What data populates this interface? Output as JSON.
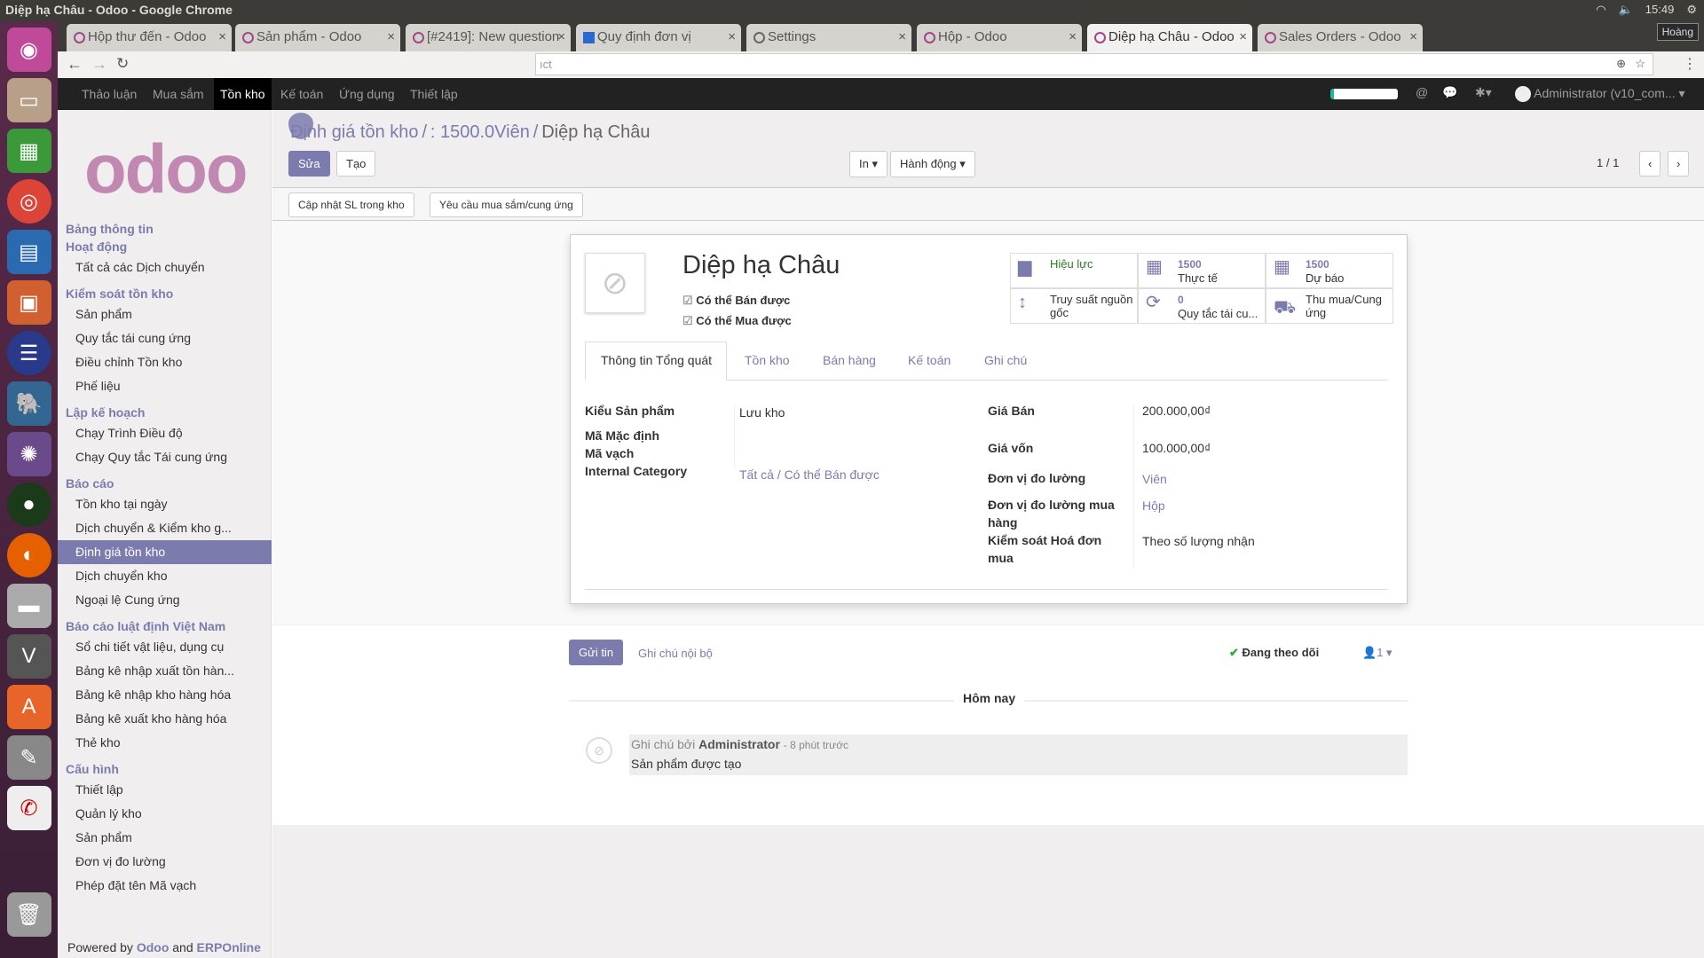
{
  "window_title": "Diệp hạ Châu - Odoo - Google Chrome",
  "tray": {
    "time": "15:49",
    "user": "Hoàng"
  },
  "tabs": [
    {
      "label": "Hộp thư đến - Odoo"
    },
    {
      "label": "Sản phẩm - Odoo"
    },
    {
      "label": "[#2419]: New question"
    },
    {
      "label": "Quy định đơn vị"
    },
    {
      "label": "Settings"
    },
    {
      "label": "Hộp - Odoo"
    },
    {
      "label": "Diệp hạ Châu - Odoo",
      "active": true
    },
    {
      "label": "Sales Orders - Odoo"
    }
  ],
  "address": "ıct",
  "topnav": {
    "items": [
      "Thảo luận",
      "Mua sắm",
      "Tồn kho",
      "Kế toán",
      "Ứng dụng",
      "Thiết lập"
    ],
    "active": "Tồn kho",
    "user": "Administrator (v10_com...",
    "accent": "#7c7bad"
  },
  "sidebar": {
    "logo": "odoo",
    "groups": [
      {
        "title": "Bảng thông tin",
        "items": []
      },
      {
        "title": "Hoạt động",
        "items": [
          "Tất cả các Dịch chuyển"
        ]
      },
      {
        "title": "Kiểm soát tồn kho",
        "items": [
          "Sản phẩm",
          "Quy tắc tái cung ứng",
          "Điều chỉnh Tồn kho",
          "Phế liệu"
        ]
      },
      {
        "title": "Lập kế hoạch",
        "items": [
          "Chạy Trình Điều độ",
          "Chạy Quy tắc Tái cung ứng"
        ]
      },
      {
        "title": "Báo cáo",
        "items": [
          "Tồn kho tại ngày",
          "Dịch chuyển & Kiểm kho g...",
          "Định giá tồn kho",
          "Dịch chuyển kho",
          "Ngoại lệ Cung ứng"
        ]
      },
      {
        "title": "Báo cáo luật định Việt Nam",
        "items": [
          "Sổ chi tiết vật liệu, dụng cụ",
          "Bảng kê nhập xuất tồn hàn...",
          "Bảng kê nhập kho hàng hóa",
          "Bảng kê xuất kho hàng hóa",
          "Thẻ kho"
        ]
      },
      {
        "title": "Cấu hình",
        "items": [
          "Thiết lập",
          "Quản lý kho",
          "Sản phẩm",
          "Đơn vị đo lường",
          "Phép đặt tên Mã vạch"
        ]
      }
    ],
    "selected": "Định giá tồn kho",
    "powered": {
      "prefix": "Powered by",
      "odoo": "Odoo",
      "and": "and",
      "erp": "ERPOnline"
    }
  },
  "control": {
    "breadcrumb": [
      "Định giá tồn kho",
      "/",
      " : 1500.0Viên",
      "/"
    ],
    "current": "Diệp hạ Châu",
    "edit": "Sửa",
    "create": "Tạo",
    "print": "In ▾",
    "action": "Hành động ▾",
    "pager": "1 / 1"
  },
  "header_buttons": [
    "Cập nhật SL trong kho",
    "Yêu cầu mua sắm/cung ứng"
  ],
  "form": {
    "name": "Diệp hạ Châu",
    "sale_ok": "Có thể Bán được",
    "purchase_ok": "Có thể Mua được",
    "stats": [
      {
        "value": "",
        "label": "Hiệu lực",
        "icon": "archive-icon"
      },
      {
        "value": "1500",
        "label": "Thực tế",
        "icon": "building-icon"
      },
      {
        "value": "1500",
        "label": "Dự báo",
        "icon": "building-icon"
      },
      {
        "value": "",
        "label": "Truy suất nguồn gốc",
        "icon": "arrows-v-icon"
      },
      {
        "value": "0",
        "label": "Quy tắc tái cu...",
        "icon": "refresh-icon"
      },
      {
        "value": "",
        "label": "Thu mua/Cung ứng",
        "icon": "truck-icon"
      }
    ],
    "tabs": [
      "Thông tin Tổng quát",
      "Tồn kho",
      "Bán hàng",
      "Kế toán",
      "Ghi chú"
    ],
    "left": [
      {
        "label": "Kiểu Sản phẩm",
        "value": "Lưu kho"
      },
      {
        "label": "Mã Mặc định",
        "value": ""
      },
      {
        "label": "Mã vạch",
        "value": ""
      },
      {
        "label": "Internal Category",
        "value": "Tất cả / Có thể Bán được"
      }
    ],
    "right": [
      {
        "label": "Giá Bán",
        "value": "200.000,00₫"
      },
      {
        "label": "Giá vốn",
        "value": "100.000,00₫"
      },
      {
        "label": "Đơn vị đo lường",
        "value": "Viên"
      },
      {
        "label": "Đơn vị đo lường mua hàng",
        "value": "Hộp"
      },
      {
        "label": "Kiểm soát Hoá đơn mua",
        "value": "Theo số lượng nhận"
      }
    ]
  },
  "chatter": {
    "send": "Gửi tin",
    "note": "Ghi chú nội bộ",
    "following": "Đang theo dõi",
    "followers": "1",
    "today": "Hôm nay",
    "msg_prefix": "Ghi chú bởi",
    "author": "Administrator",
    "time": "- 8 phút trước",
    "body": "Sản phẩm được tạo"
  }
}
